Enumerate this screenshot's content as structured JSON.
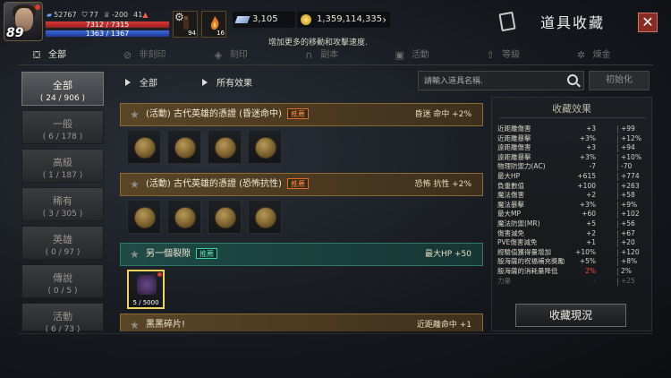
{
  "player": {
    "level": "89",
    "stats": [
      "52767",
      "77",
      "-200",
      "41"
    ],
    "hp": "7312 / 7315",
    "mp": "1363 / 1367",
    "slot_count_1": "94",
    "slot_count_2": "16"
  },
  "currency": {
    "gem": "3,105",
    "gold": "1,359,114,335"
  },
  "hint": "增加更多的移動和攻擊速度.",
  "title": "道具收藏",
  "close_label": "✕",
  "categories": [
    {
      "label": "全部",
      "icon": "all-icon"
    },
    {
      "label": "非刻印",
      "icon": "no-engrave-icon"
    },
    {
      "label": "刻印",
      "icon": "engrave-icon"
    },
    {
      "label": "副本",
      "icon": "dungeon-icon"
    },
    {
      "label": "活動",
      "icon": "gift-icon"
    },
    {
      "label": "等級",
      "icon": "level-icon"
    },
    {
      "label": "煉金",
      "icon": "alchemy-icon"
    }
  ],
  "sidebar": [
    {
      "name": "全部",
      "count": "( 24 / 906 )"
    },
    {
      "name": "一般",
      "count": "( 6 / 178 )"
    },
    {
      "name": "高級",
      "count": "( 1 / 187 )"
    },
    {
      "name": "稀有",
      "count": "( 3 / 305 )"
    },
    {
      "name": "英雄",
      "count": "( 0 / 97 )"
    },
    {
      "name": "傳說",
      "count": "( 0 / 5 )"
    },
    {
      "name": "活動",
      "count": "( 6 / 73 )"
    }
  ],
  "filters": {
    "f1": "全部",
    "f2": "所有效果",
    "search_placeholder": "請輸入道具名稱.",
    "reset_label": "初始化"
  },
  "groups": [
    {
      "name": "(活動) 古代英雄的憑證 (昏迷命中)",
      "badge": "推薦",
      "effect": "昏迷 命中 +2%"
    },
    {
      "name": "(活動) 古代英雄的憑證 (恐怖抗性)",
      "badge": "推薦",
      "effect": "恐怖 抗性 +2%"
    },
    {
      "name": "另一個裂隙",
      "badge": "推薦",
      "effect": "最大HP +50"
    },
    {
      "name": "黑黑碎片!",
      "badge": "",
      "effect": "近距離命中 +1"
    }
  ],
  "owned_slot_count": "5 / 5000",
  "effects_title": "收藏效果",
  "effects": [
    {
      "name": "近距離傷害",
      "a": "+3",
      "b": "+99"
    },
    {
      "name": "近距離暴擊",
      "a": "+3%",
      "b": "+12%"
    },
    {
      "name": "遠距離傷害",
      "a": "+3",
      "b": "+94"
    },
    {
      "name": "遠距離暴擊",
      "a": "+3%",
      "b": "+10%"
    },
    {
      "name": "物理防禦力(AC)",
      "a": "-7",
      "b": "-70"
    },
    {
      "name": "最大HP",
      "a": "+615",
      "b": "+774"
    },
    {
      "name": "負重數值",
      "a": "+100",
      "b": "+263"
    },
    {
      "name": "魔法傷害",
      "a": "+2",
      "b": "+58"
    },
    {
      "name": "魔法暴擊",
      "a": "+3%",
      "b": "+9%"
    },
    {
      "name": "最大MP",
      "a": "+60",
      "b": "+102"
    },
    {
      "name": "魔法防禦(MR)",
      "a": "+5",
      "b": "+56"
    },
    {
      "name": "傷害減免",
      "a": "+2",
      "b": "+67"
    },
    {
      "name": "PVE傷害減免",
      "a": "+1",
      "b": "+20"
    },
    {
      "name": "經驗值獲得量增加",
      "a": "+10%",
      "b": "+120"
    },
    {
      "name": "殷海薩的祝福補充獎勵",
      "a": "+5%",
      "b": "+8%"
    },
    {
      "name": "殷海薩的消耗量降低",
      "a": "2%",
      "b": "2%",
      "red": true
    },
    {
      "name": "力量",
      "a": "-",
      "b": "+25",
      "dim": true
    }
  ],
  "collect_button": "收藏現況",
  "colors": {
    "accent_gold": "#f0d35a",
    "badge_orange": "#ff8a3a",
    "close_red": "#8a2a22"
  }
}
